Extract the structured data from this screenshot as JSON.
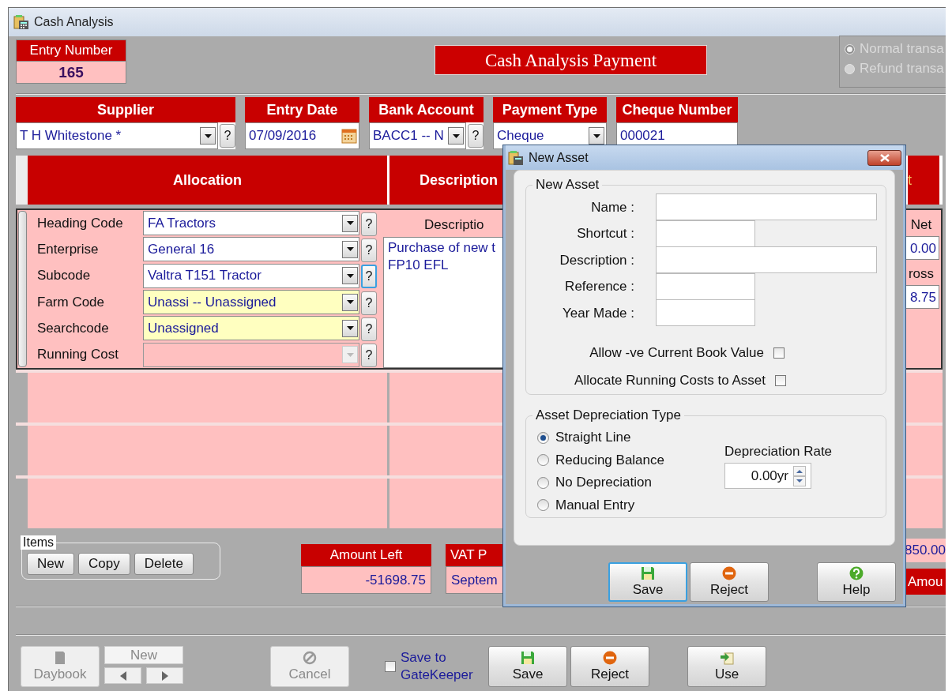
{
  "window": {
    "title": "Cash Analysis"
  },
  "entry_number": {
    "label": "Entry Number",
    "value": "165"
  },
  "form_title": "Cash Analysis Payment",
  "transaction_type": {
    "disabled": true,
    "options": [
      {
        "label": "Normal transa",
        "selected": true
      },
      {
        "label": "Refund transa",
        "selected": false
      }
    ]
  },
  "header_fields": [
    {
      "label": "Supplier",
      "kind": "combo",
      "value": "T H Whitestone *",
      "help": "?"
    },
    {
      "label": "Entry Date",
      "kind": "date",
      "value": "07/09/2016"
    },
    {
      "label": "Bank Account",
      "kind": "combo",
      "value": "BACC1 -- N",
      "help": "?"
    },
    {
      "label": "Payment Type",
      "kind": "combo",
      "value": "Cheque"
    },
    {
      "label": "Cheque Number",
      "kind": "text",
      "value": "000021"
    }
  ],
  "grid": {
    "columns": [
      "Allocation",
      "Description",
      "t"
    ],
    "allocation": [
      {
        "label": "Heading Code",
        "value": "FA Tractors",
        "help": "?",
        "highlighted": false,
        "disabled": false,
        "focused": false
      },
      {
        "label": "Enterprise",
        "value": "General 16",
        "help": "?",
        "highlighted": false,
        "disabled": false,
        "focused": false
      },
      {
        "label": "Subcode",
        "value": "Valtra T151 Tractor",
        "help": "?",
        "highlighted": false,
        "disabled": false,
        "focused": true
      },
      {
        "label": "Farm Code",
        "value": "Unassi -- Unassigned",
        "help": "?",
        "highlighted": true,
        "disabled": false,
        "focused": false
      },
      {
        "label": "Searchcode",
        "value": "Unassigned",
        "help": "?",
        "highlighted": true,
        "disabled": false,
        "focused": false
      },
      {
        "label": "Running Cost",
        "help": "?",
        "highlighted": false,
        "disabled": true,
        "focused": false
      }
    ],
    "description_label": "Descriptio",
    "description_lines": [
      "Purchase of new t",
      "FP10 EFL"
    ],
    "amounts": [
      {
        "label": "Net",
        "value": "0.00"
      },
      {
        "label": "ross",
        "value": "8.75"
      }
    ]
  },
  "items": {
    "title": "Items",
    "buttons": [
      "New",
      "Copy",
      "Delete"
    ]
  },
  "totals": [
    {
      "label": "Amount Left",
      "value": "-51698.75"
    },
    {
      "label": "VAT P",
      "value": "Septem"
    }
  ],
  "right_total": {
    "value": "850.00",
    "label": "Amou"
  },
  "footer": {
    "daybook": {
      "label": "Daybook",
      "disabled": true
    },
    "new_record": {
      "label": "New",
      "disabled": true
    },
    "cancel": {
      "label": "Cancel",
      "disabled": true
    },
    "gatekeeper": {
      "label": "Save to GateKeeper",
      "checked": false
    },
    "actions": [
      {
        "label": "Save",
        "kind": "save"
      },
      {
        "label": "Reject",
        "kind": "reject"
      },
      {
        "label": "Use",
        "kind": "use"
      }
    ]
  },
  "dialog": {
    "title": "New Asset",
    "group_title": "New Asset",
    "fields": [
      {
        "label": "Name :",
        "kind": "wide"
      },
      {
        "label": "Shortcut :",
        "kind": "short"
      },
      {
        "label": "Description :",
        "kind": "wide"
      },
      {
        "label": "Reference :",
        "kind": "short"
      },
      {
        "label": "Year Made :",
        "kind": "short"
      }
    ],
    "checkboxes": [
      {
        "label": "Allow -ve Current Book Value",
        "checked": false
      },
      {
        "label": "Allocate Running Costs to Asset",
        "checked": false
      }
    ],
    "depreciation_title": "Asset Depreciation Type",
    "depreciation_types": [
      {
        "label": "Straight Line",
        "selected": true
      },
      {
        "label": "Reducing Balance",
        "selected": false
      },
      {
        "label": "No Depreciation",
        "selected": false
      },
      {
        "label": "Manual Entry",
        "selected": false
      }
    ],
    "rate_label": "Depreciation Rate",
    "rate_value": "0.00yr",
    "buttons": [
      {
        "label": "Save",
        "kind": "save",
        "focused": true
      },
      {
        "label": "Reject",
        "kind": "reject",
        "focused": false
      },
      {
        "label": "Help",
        "kind": "help",
        "focused": false
      }
    ]
  }
}
